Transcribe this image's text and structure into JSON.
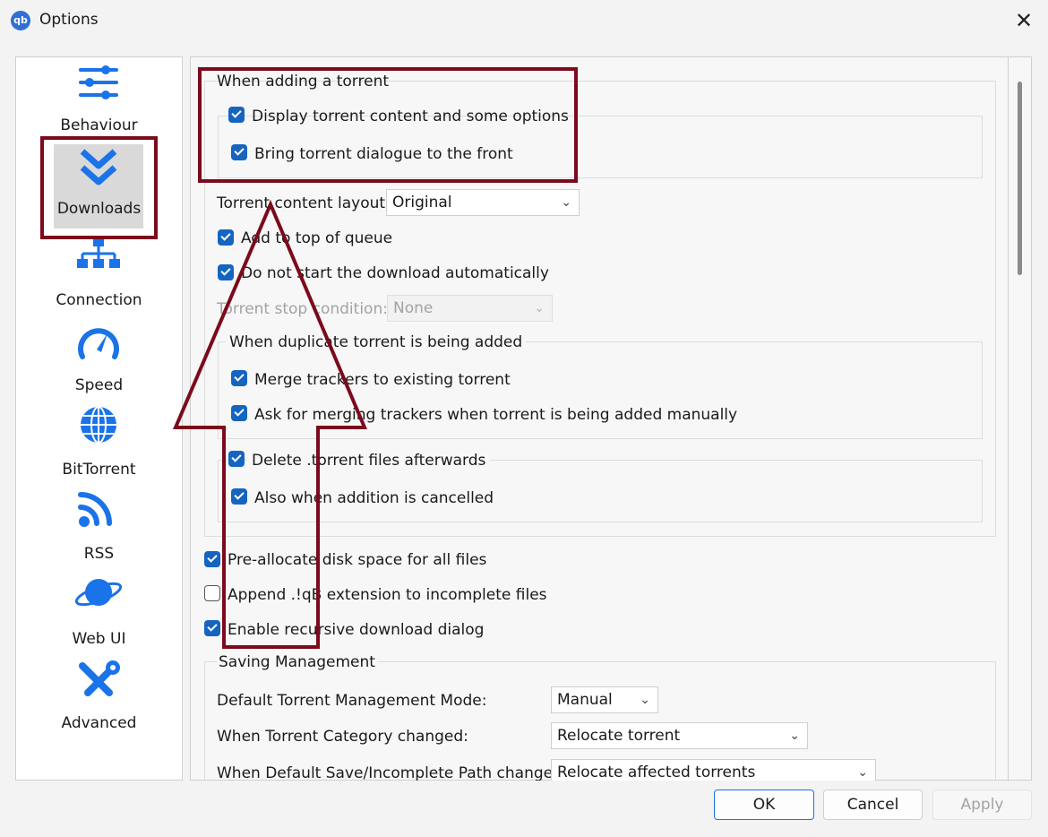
{
  "window": {
    "title": "Options",
    "app_icon": "qb",
    "close": "✕"
  },
  "sidebar": {
    "items": [
      {
        "label": "Behaviour",
        "icon": "sliders-icon"
      },
      {
        "label": "Downloads",
        "icon": "double-chevron-down-icon"
      },
      {
        "label": "Connection",
        "icon": "network-icon"
      },
      {
        "label": "Speed",
        "icon": "speedometer-icon"
      },
      {
        "label": "BitTorrent",
        "icon": "globe-icon"
      },
      {
        "label": "RSS",
        "icon": "rss-icon"
      },
      {
        "label": "Web UI",
        "icon": "planet-icon"
      },
      {
        "label": "Advanced",
        "icon": "tools-icon"
      }
    ],
    "selected": "Downloads"
  },
  "adding": {
    "title": "When adding a torrent",
    "display_content": {
      "label": "Display torrent content and some options",
      "checked": true
    },
    "bring_front": {
      "label": "Bring torrent dialogue to the front",
      "checked": true
    },
    "layout_label": "Torrent content layout:",
    "layout_value": "Original",
    "add_top": {
      "label": "Add to top of queue",
      "checked": true
    },
    "no_start": {
      "label": "Do not start the download automatically",
      "checked": true
    },
    "stop_label": "Torrent stop condition:",
    "stop_value": "None",
    "duplicate_title": "When duplicate torrent is being added",
    "merge": {
      "label": "Merge trackers to existing torrent",
      "checked": true
    },
    "ask_merge": {
      "label": "Ask for merging trackers when torrent is being added manually",
      "checked": true
    },
    "delete_files": {
      "label": "Delete .torrent files afterwards",
      "checked": true
    },
    "also_cancel": {
      "label": "Also when addition is cancelled",
      "checked": true
    }
  },
  "disk": {
    "prealloc": {
      "label": "Pre-allocate disk space for all files",
      "checked": true
    },
    "append_ext": {
      "label": "Append .!qB extension to incomplete files",
      "checked": false
    },
    "recursive": {
      "label": "Enable recursive download dialog",
      "checked": true
    }
  },
  "saving": {
    "title": "Saving Management",
    "mode_label": "Default Torrent Management Mode:",
    "mode_value": "Manual",
    "category_label": "When Torrent Category changed:",
    "category_value": "Relocate torrent",
    "path_label": "When Default Save/Incomplete Path changed:",
    "path_value": "Relocate affected torrents"
  },
  "buttons": {
    "ok": "OK",
    "cancel": "Cancel",
    "apply": "Apply"
  },
  "colors": {
    "accent": "#1565c0",
    "highlight": "#7b0a1d"
  }
}
